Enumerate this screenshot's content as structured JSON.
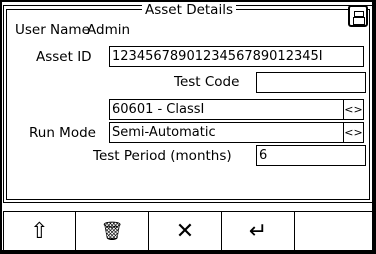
{
  "dialog": {
    "title": "Asset Details",
    "user_name_label": "User Name",
    "user_name_value": "Admin",
    "print_icon": "printer-icon"
  },
  "form": {
    "asset_id_label": "Asset ID",
    "asset_id_value": "1234567890123456789012345I",
    "test_code_label": "Test Code",
    "test_code_value": "",
    "class_value": "60601 - ClassI",
    "class_arrows": "<>",
    "run_mode_label": "Run Mode",
    "run_mode_value": "Semi-Automatic",
    "run_mode_arrows": "<>",
    "test_period_label": "Test Period (months)",
    "test_period_value": "6"
  },
  "toolbar": {
    "up_glyph": "⇧",
    "delete_glyph": "🗑",
    "close_glyph": "✕",
    "enter_glyph": "↵"
  }
}
